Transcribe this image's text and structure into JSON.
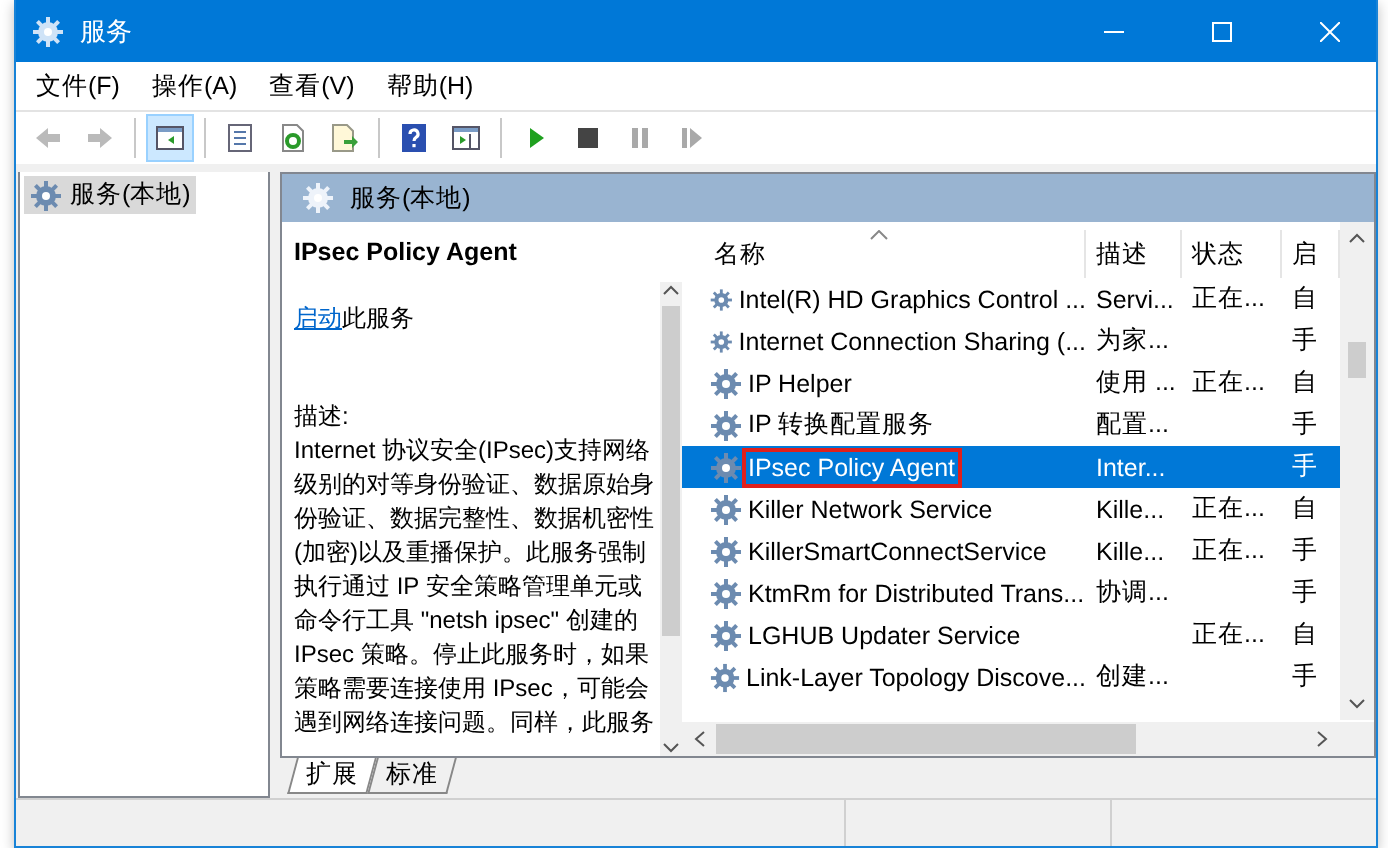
{
  "window": {
    "title": "服务"
  },
  "menu": [
    "文件(F)",
    "操作(A)",
    "查看(V)",
    "帮助(H)"
  ],
  "toolbar": [
    {
      "kind": "back",
      "disabled": true
    },
    {
      "kind": "forward",
      "disabled": true
    },
    {
      "kind": "sep"
    },
    {
      "kind": "tree",
      "pressed": true
    },
    {
      "kind": "sep"
    },
    {
      "kind": "properties"
    },
    {
      "kind": "refresh"
    },
    {
      "kind": "export"
    },
    {
      "kind": "sep"
    },
    {
      "kind": "help"
    },
    {
      "kind": "pane"
    },
    {
      "kind": "sep"
    },
    {
      "kind": "play"
    },
    {
      "kind": "stop"
    },
    {
      "kind": "pause",
      "disabled": true
    },
    {
      "kind": "resume",
      "disabled": true
    }
  ],
  "tree": [
    {
      "label": "服务(本地)",
      "selected": true
    }
  ],
  "panel": {
    "title": "服务(本地)",
    "detail": {
      "name": "IPsec Policy Agent",
      "action_link": "启动",
      "action_text": "此服务",
      "description_label": "描述:",
      "description": "Internet 协议安全(IPsec)支持网络级别的对等身份验证、数据原始身份验证、数据完整性、数据机密性(加密)以及重播保护。此服务强制执行通过 IP 安全策略管理单元或命令行工具 \"netsh ipsec\" 创建的 IPsec 策略。停止此服务时，如果策略需要连接使用 IPsec，可能会遇到网络连接问题。同样，此服务"
    },
    "columns": [
      "名称",
      "描述",
      "状态",
      "启"
    ],
    "rows": [
      {
        "name": "Intel(R) HD Graphics Control ...",
        "desc": "Servi...",
        "status": "正在...",
        "startup": "自",
        "selected": false
      },
      {
        "name": "Internet Connection Sharing (...",
        "desc": "为家...",
        "status": "",
        "startup": "手",
        "selected": false
      },
      {
        "name": "IP Helper",
        "desc": "使用 ...",
        "status": "正在...",
        "startup": "自",
        "selected": false
      },
      {
        "name": "IP 转换配置服务",
        "desc": "配置...",
        "status": "",
        "startup": "手",
        "selected": false
      },
      {
        "name": "IPsec Policy Agent",
        "desc": "Inter...",
        "status": "",
        "startup": "手",
        "selected": true,
        "highlighted": true
      },
      {
        "name": "Killer Network Service",
        "desc": "Kille...",
        "status": "正在...",
        "startup": "自",
        "selected": false
      },
      {
        "name": "KillerSmartConnectService",
        "desc": "Kille...",
        "status": "正在...",
        "startup": "手",
        "selected": false
      },
      {
        "name": "KtmRm for Distributed Trans...",
        "desc": "协调...",
        "status": "",
        "startup": "手",
        "selected": false
      },
      {
        "name": "LGHUB Updater Service",
        "desc": "",
        "status": "正在...",
        "startup": "自",
        "selected": false
      },
      {
        "name": "Link-Layer Topology Discove...",
        "desc": "创建...",
        "status": "",
        "startup": "手",
        "selected": false
      }
    ],
    "tabs": [
      {
        "label": "扩展",
        "selected": true
      },
      {
        "label": "标准",
        "selected": false
      }
    ]
  }
}
